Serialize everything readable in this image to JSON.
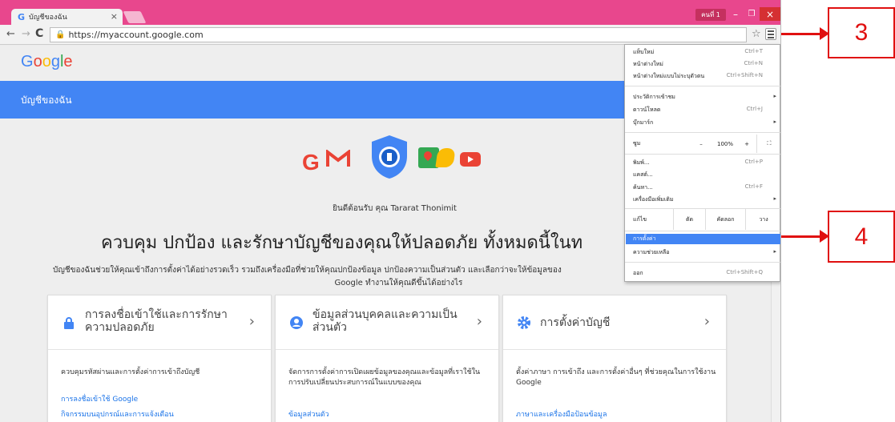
{
  "browser": {
    "tab_title": "บัญชีของฉัน",
    "tab_close": "×",
    "profile_label": "คนที่ 1",
    "url": "https://myaccount.google.com",
    "controls": {
      "minimize": "–",
      "maximize": "❐",
      "close": "×"
    }
  },
  "page": {
    "logo_letters": [
      "G",
      "o",
      "o",
      "g",
      "l",
      "e"
    ],
    "header_title": "บัญชีของฉัน",
    "welcome": "ยินดีต้อนรับ คุณ Tararat Thonimit",
    "headline": "ควบคุม ปกป้อง และรักษาบัญชีของคุณให้ปลอดภัย ทั้งหมดนี้ในท",
    "description_line1": "บัญชีของฉันช่วยให้คุณเข้าถึงการตั้งค่าได้อย่างรวดเร็ว รวมถึงเครื่องมือที่ช่วยให้คุณปกป้องข้อมูล ปกป้องความเป็นส่วนตัว และเลือกว่าจะให้ข้อมูลของ",
    "description_line2": "Google ทำงานให้คุณดีขึ้นได้อย่างไร",
    "cards": [
      {
        "title": "การลงชื่อเข้าใช้และการรักษาความปลอดภัย",
        "description": "ควบคุมรหัสผ่านและการตั้งค่าการเข้าถึงบัญชี",
        "links": [
          "การลงชื่อเข้าใช้ Google",
          "กิจกรรมบนอุปกรณ์และการแจ้งเตือน"
        ]
      },
      {
        "title": "ข้อมูลส่วนบุคคลและความเป็นส่วนตัว",
        "description": "จัดการการตั้งค่าการเปิดเผยข้อมูลของคุณและข้อมูลที่เราใช้ในการปรับเปลี่ยนประสบการณ์ในแบบของคุณ",
        "links": [
          "ข้อมูลส่วนตัว"
        ]
      },
      {
        "title": "การตั้งค่าบัญชี",
        "description": "ตั้งค่าภาษา การเข้าถึง และการตั้งค่าอื่นๆ ที่ช่วยคุณในการใช้งาน Google",
        "links": [
          "ภาษาและเครื่องมือป้อนข้อมูล"
        ]
      }
    ],
    "chevron": "›"
  },
  "menu": {
    "items_top": [
      {
        "label": "แท็บใหม่",
        "shortcut": "Ctrl+T"
      },
      {
        "label": "หน้าต่างใหม่",
        "shortcut": "Ctrl+N"
      },
      {
        "label": "หน้าต่างใหม่แบบไม่ระบุตัวตน",
        "shortcut": "Ctrl+Shift+N"
      }
    ],
    "items_mid": [
      {
        "label": "ประวัติการเข้าชม",
        "shortcut": "",
        "arrow": "▸"
      },
      {
        "label": "ดาวน์โหลด",
        "shortcut": "Ctrl+J",
        "arrow": ""
      },
      {
        "label": "บุ๊กมาร์ก",
        "shortcut": "",
        "arrow": "▸"
      }
    ],
    "zoom_label": "ซูม",
    "zoom_minus": "–",
    "zoom_value": "100%",
    "zoom_plus": "+",
    "zoom_fullscreen": "⛶",
    "items_tools": [
      {
        "label": "พิมพ์...",
        "shortcut": "Ctrl+P",
        "arrow": ""
      },
      {
        "label": "แคสต์...",
        "shortcut": "",
        "arrow": ""
      },
      {
        "label": "ค้นหา...",
        "shortcut": "Ctrl+F",
        "arrow": ""
      },
      {
        "label": "เครื่องมือเพิ่มเติม",
        "shortcut": "",
        "arrow": "▸"
      }
    ],
    "edit_label": "แก้ไข",
    "edit_cut": "ตัด",
    "edit_copy": "คัดลอก",
    "edit_paste": "วาง",
    "settings": "การตั้งค่า",
    "help": "ความช่วยเหลือ",
    "help_arrow": "▸",
    "exit": "ออก",
    "exit_shortcut": "Ctrl+Shift+Q"
  },
  "callouts": {
    "label_3": "3",
    "label_4": "4"
  },
  "colors": {
    "tab_strip": "#e8478d",
    "header_blue": "#4285f4",
    "callout_red": "#e01010"
  }
}
